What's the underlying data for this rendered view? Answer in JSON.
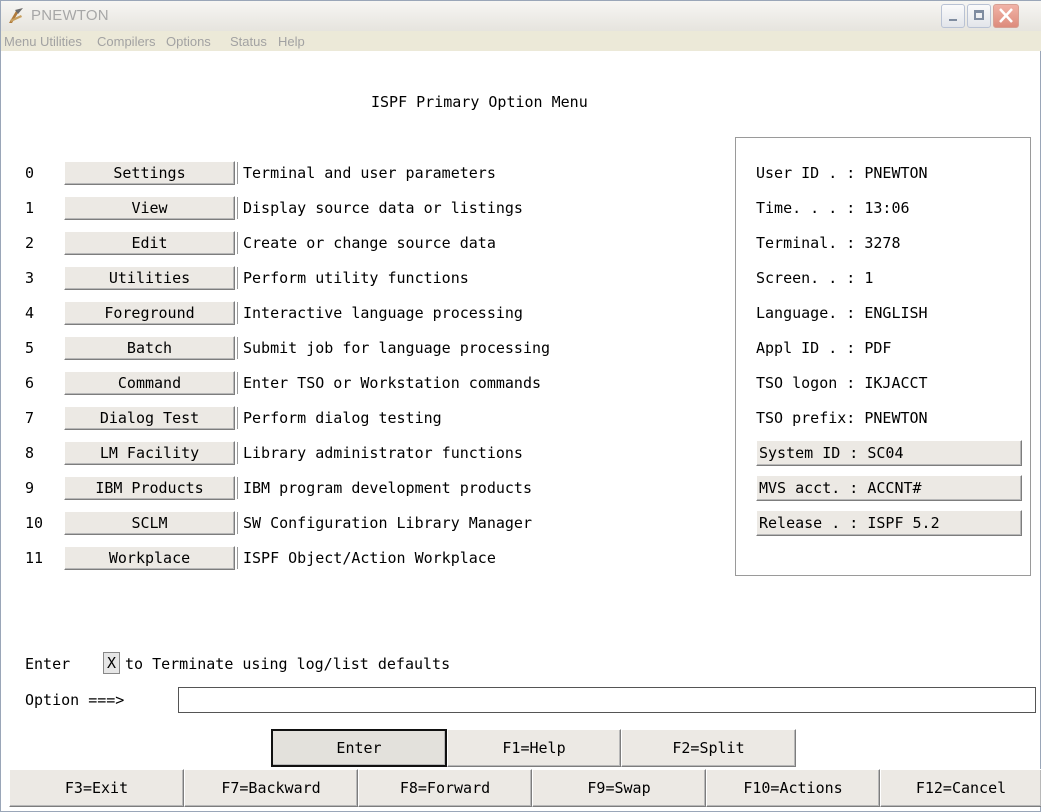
{
  "window": {
    "title": "PNEWTON"
  },
  "menubar": [
    "Menu",
    "Utilities",
    "Compilers",
    "Options",
    "Status",
    "Help"
  ],
  "panel_title": "ISPF Primary Option Menu",
  "options": [
    {
      "num": "0",
      "label": "Settings",
      "desc": "Terminal and user parameters"
    },
    {
      "num": "1",
      "label": "View",
      "desc": "Display source data or listings"
    },
    {
      "num": "2",
      "label": "Edit",
      "desc": "Create or change source data"
    },
    {
      "num": "3",
      "label": "Utilities",
      "desc": "Perform utility functions"
    },
    {
      "num": "4",
      "label": "Foreground",
      "desc": "Interactive language processing"
    },
    {
      "num": "5",
      "label": "Batch",
      "desc": "Submit job for language processing"
    },
    {
      "num": "6",
      "label": "Command",
      "desc": "Enter TSO or Workstation commands"
    },
    {
      "num": "7",
      "label": "Dialog Test",
      "desc": "Perform dialog testing"
    },
    {
      "num": "8",
      "label": "LM Facility",
      "desc": "Library administrator functions"
    },
    {
      "num": "9",
      "label": "IBM Products",
      "desc": "IBM program development products"
    },
    {
      "num": "10",
      "label": "SCLM",
      "desc": "SW Configuration Library Manager"
    },
    {
      "num": "11",
      "label": "Workplace",
      "desc": "ISPF Object/Action Workplace"
    }
  ],
  "info": [
    "User ID . : PNEWTON",
    "Time. . . : 13:06",
    "Terminal. : 3278",
    "Screen. . : 1",
    "Language. : ENGLISH",
    "Appl ID . : PDF",
    "TSO logon : IKJACCT",
    "TSO prefix: PNEWTON"
  ],
  "info_buttons": [
    "System ID : SC04",
    "MVS acct. : ACCNT#",
    "Release . : ISPF 5.2"
  ],
  "terminate": {
    "prefix": "Enter",
    "field": "X",
    "suffix": "to Terminate using log/list defaults"
  },
  "option_prompt": "Option ===>",
  "option_value": "",
  "row1_keys": [
    "Enter",
    "F1=Help",
    "F2=Split"
  ],
  "row2_keys": [
    "F3=Exit",
    "F7=Backward",
    "F8=Forward",
    "F9=Swap",
    "F10=Actions",
    "F12=Cancel"
  ]
}
